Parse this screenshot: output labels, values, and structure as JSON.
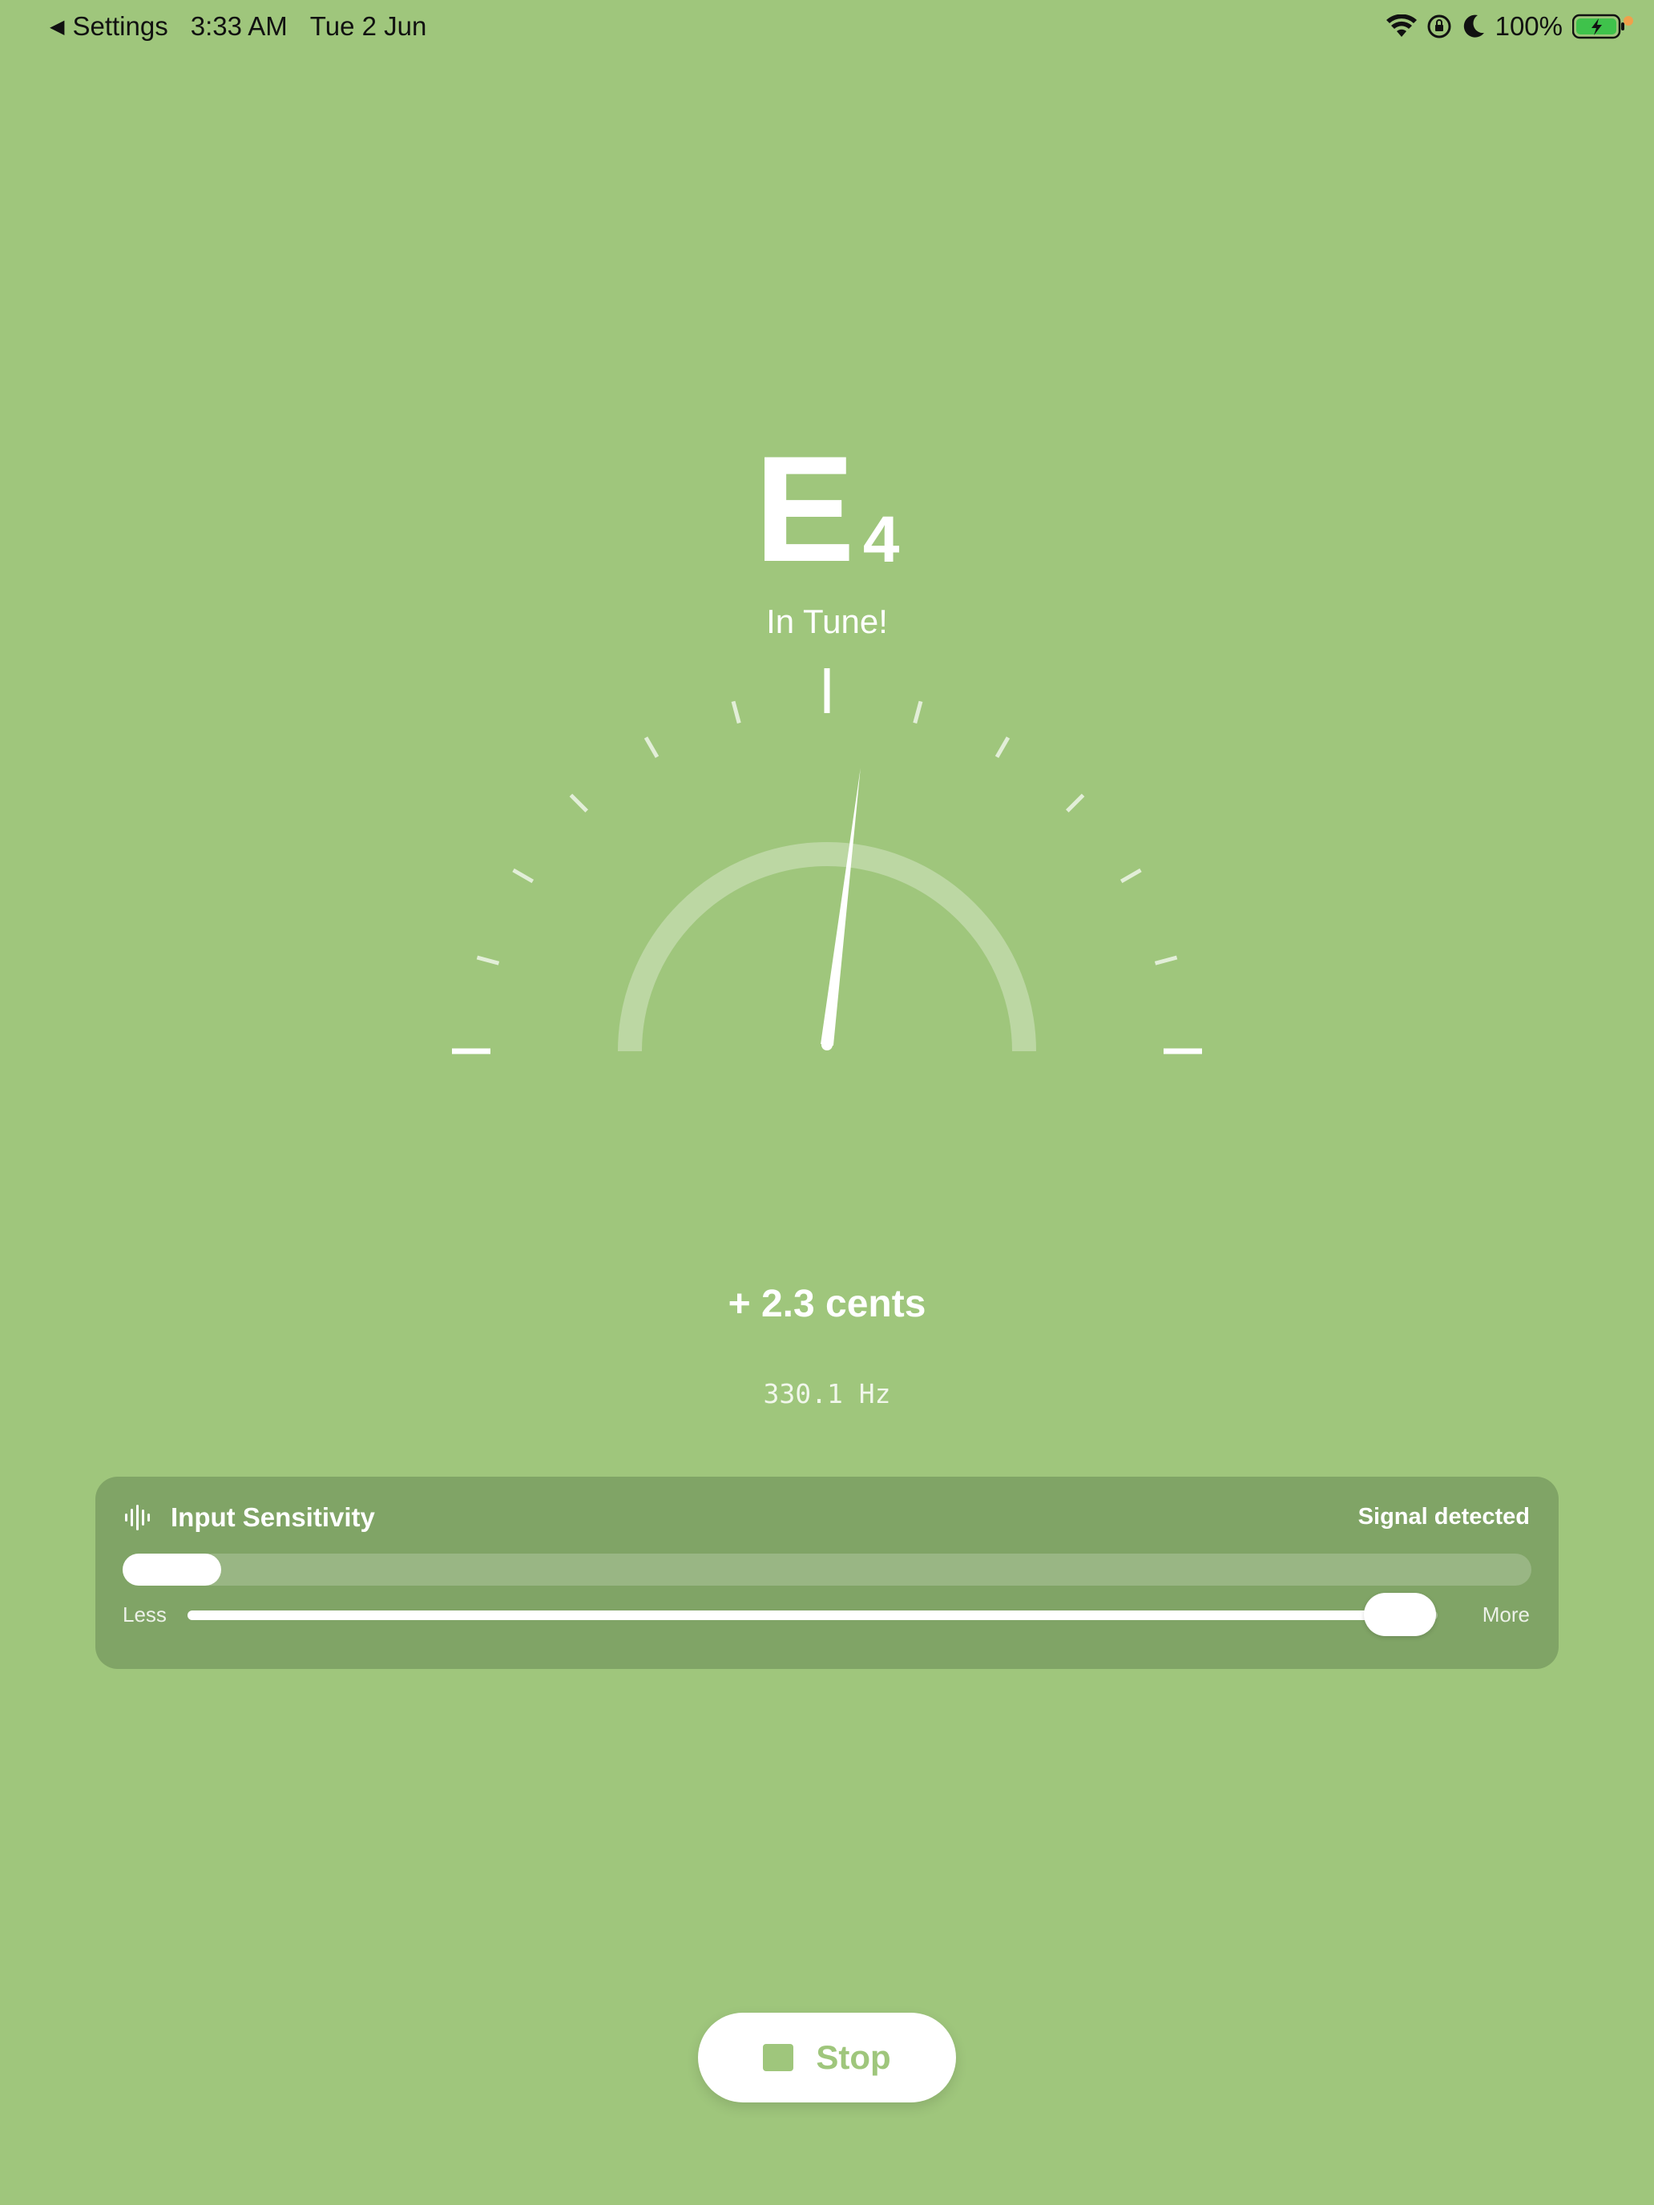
{
  "status_bar": {
    "back_label": "Settings",
    "time": "3:33 AM",
    "date": "Tue 2 Jun",
    "battery": "100%",
    "icons": [
      "wifi-icon",
      "orientation-lock-icon",
      "moon-icon",
      "battery-charging-icon"
    ]
  },
  "tuner": {
    "note": "E",
    "octave": "4",
    "status": "In Tune!",
    "cents_text": "+ 2.3 cents",
    "frequency_text": "330.1 Hz",
    "cents_value": 2.3
  },
  "sensitivity": {
    "title": "Input Sensitivity",
    "signal_status": "Signal detected",
    "less_label": "Less",
    "more_label": "More",
    "input_level": 0.07,
    "slider_value": 0.97
  },
  "controls": {
    "stop_label": "Stop"
  },
  "colors": {
    "background": "#9fc67c",
    "panel": "#80a466",
    "accent": "#ffffff"
  }
}
